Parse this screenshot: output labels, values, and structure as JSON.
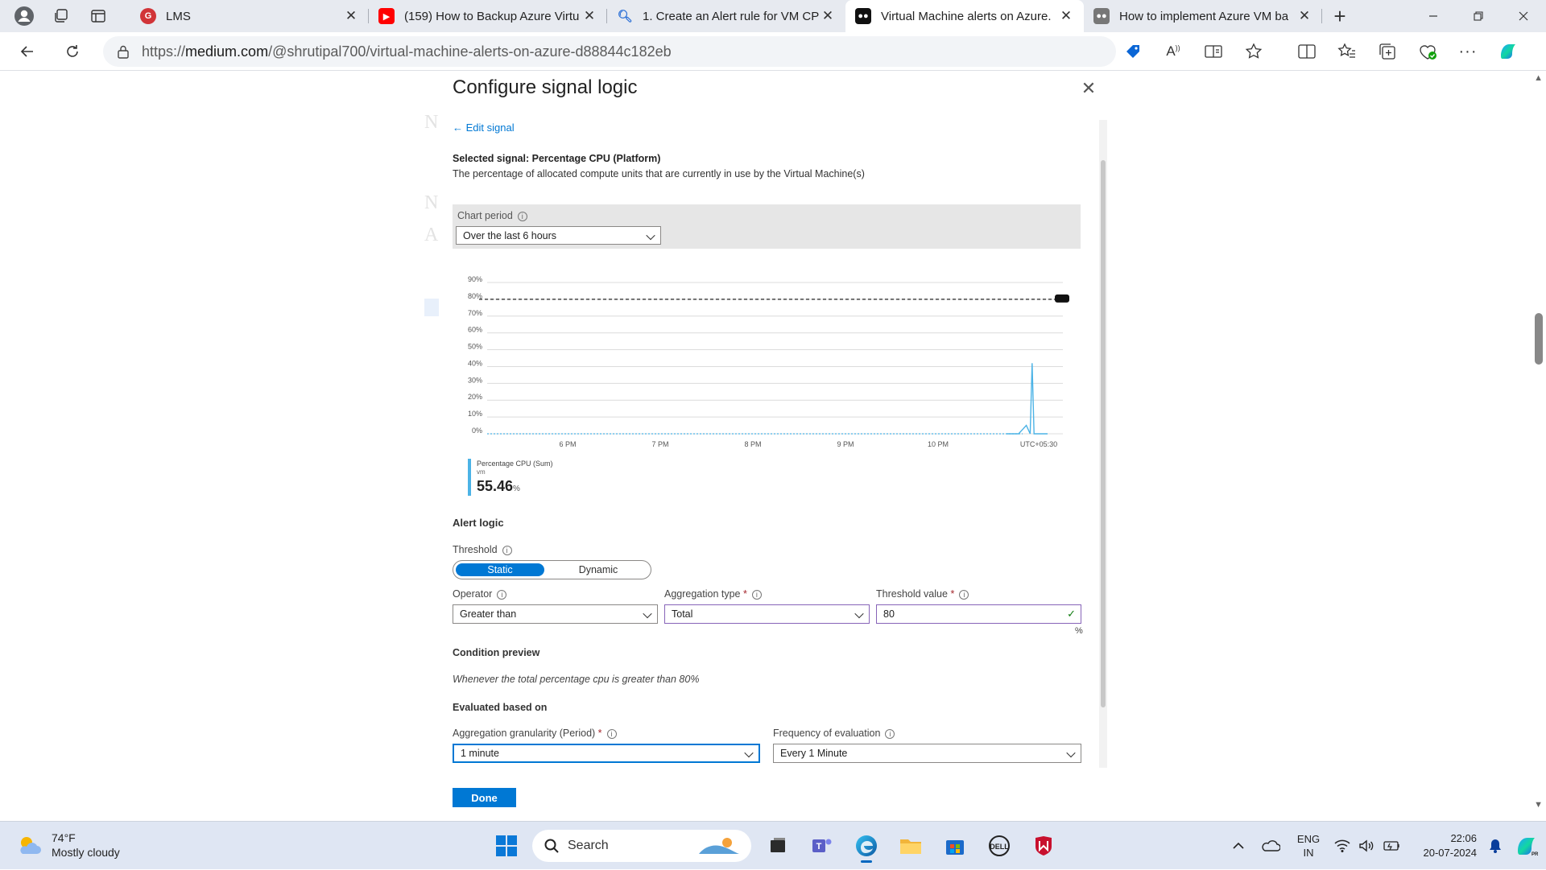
{
  "browser": {
    "tabs": [
      {
        "title": "LMS",
        "favicon": "lms-favicon"
      },
      {
        "title": "(159) How to Backup Azure Virtu",
        "favicon": "youtube-favicon"
      },
      {
        "title": "1. Create an Alert rule for VM CP",
        "favicon": "search-favicon"
      },
      {
        "title": "Virtual Machine alerts on Azure.",
        "favicon": "medium-favicon",
        "active": true
      },
      {
        "title": "How to implement Azure VM ba",
        "favicon": "medium-favicon"
      }
    ],
    "url_prefix": "https://",
    "url_host": "medium.com",
    "url_path": "/@shrutipal700/virtual-machine-alerts-on-azure-d88844c182eb"
  },
  "dialog": {
    "title": "Configure signal logic",
    "edit_signal": "Edit signal",
    "selected_signal": "Selected signal: Percentage CPU (Platform)",
    "signal_description": "The percentage of allocated compute units that are currently in use by the Virtual Machine(s)",
    "chart_period_label": "Chart period",
    "chart_period_value": "Over the last 6 hours",
    "legend_name": "Percentage CPU (Sum)",
    "legend_resource": "vm",
    "legend_value": "55.46",
    "legend_unit": "%",
    "alert_logic": "Alert logic",
    "threshold_label": "Threshold",
    "threshold_static": "Static",
    "threshold_dynamic": "Dynamic",
    "operator_label": "Operator",
    "operator_value": "Greater than",
    "aggregation_type_label": "Aggregation type",
    "aggregation_type_value": "Total",
    "threshold_value_label": "Threshold value",
    "threshold_value": "80",
    "threshold_unit": "%",
    "condition_preview_title": "Condition preview",
    "condition_preview_text": "Whenever the total percentage cpu is greater than 80%",
    "evaluated_title": "Evaluated based on",
    "granularity_label": "Aggregation granularity (Period)",
    "granularity_value": "1 minute",
    "frequency_label": "Frequency of evaluation",
    "frequency_value": "Every 1 Minute",
    "done_label": "Done",
    "required_mark": "*"
  },
  "chart_data": {
    "type": "line",
    "y_ticks": [
      "90%",
      "80%",
      "70%",
      "60%",
      "50%",
      "40%",
      "30%",
      "20%",
      "10%",
      "0%"
    ],
    "x_ticks": [
      "6 PM",
      "7 PM",
      "8 PM",
      "9 PM",
      "10 PM",
      "UTC+05:30"
    ],
    "ylim": [
      0,
      90
    ],
    "threshold": 80,
    "series": [
      {
        "name": "Percentage CPU (Sum)",
        "color": "#4cb3e6",
        "x": [
          0,
          5.7,
          5.78,
          5.82,
          5.84,
          5.86,
          5.9,
          6
        ],
        "y": [
          0,
          0,
          5,
          0,
          42,
          0,
          0,
          0
        ]
      }
    ]
  },
  "taskbar": {
    "temperature": "74°F",
    "weather": "Mostly cloudy",
    "search_placeholder": "Search",
    "lang_top": "ENG",
    "lang_bottom": "IN",
    "time": "22:06",
    "date": "20-07-2024"
  }
}
